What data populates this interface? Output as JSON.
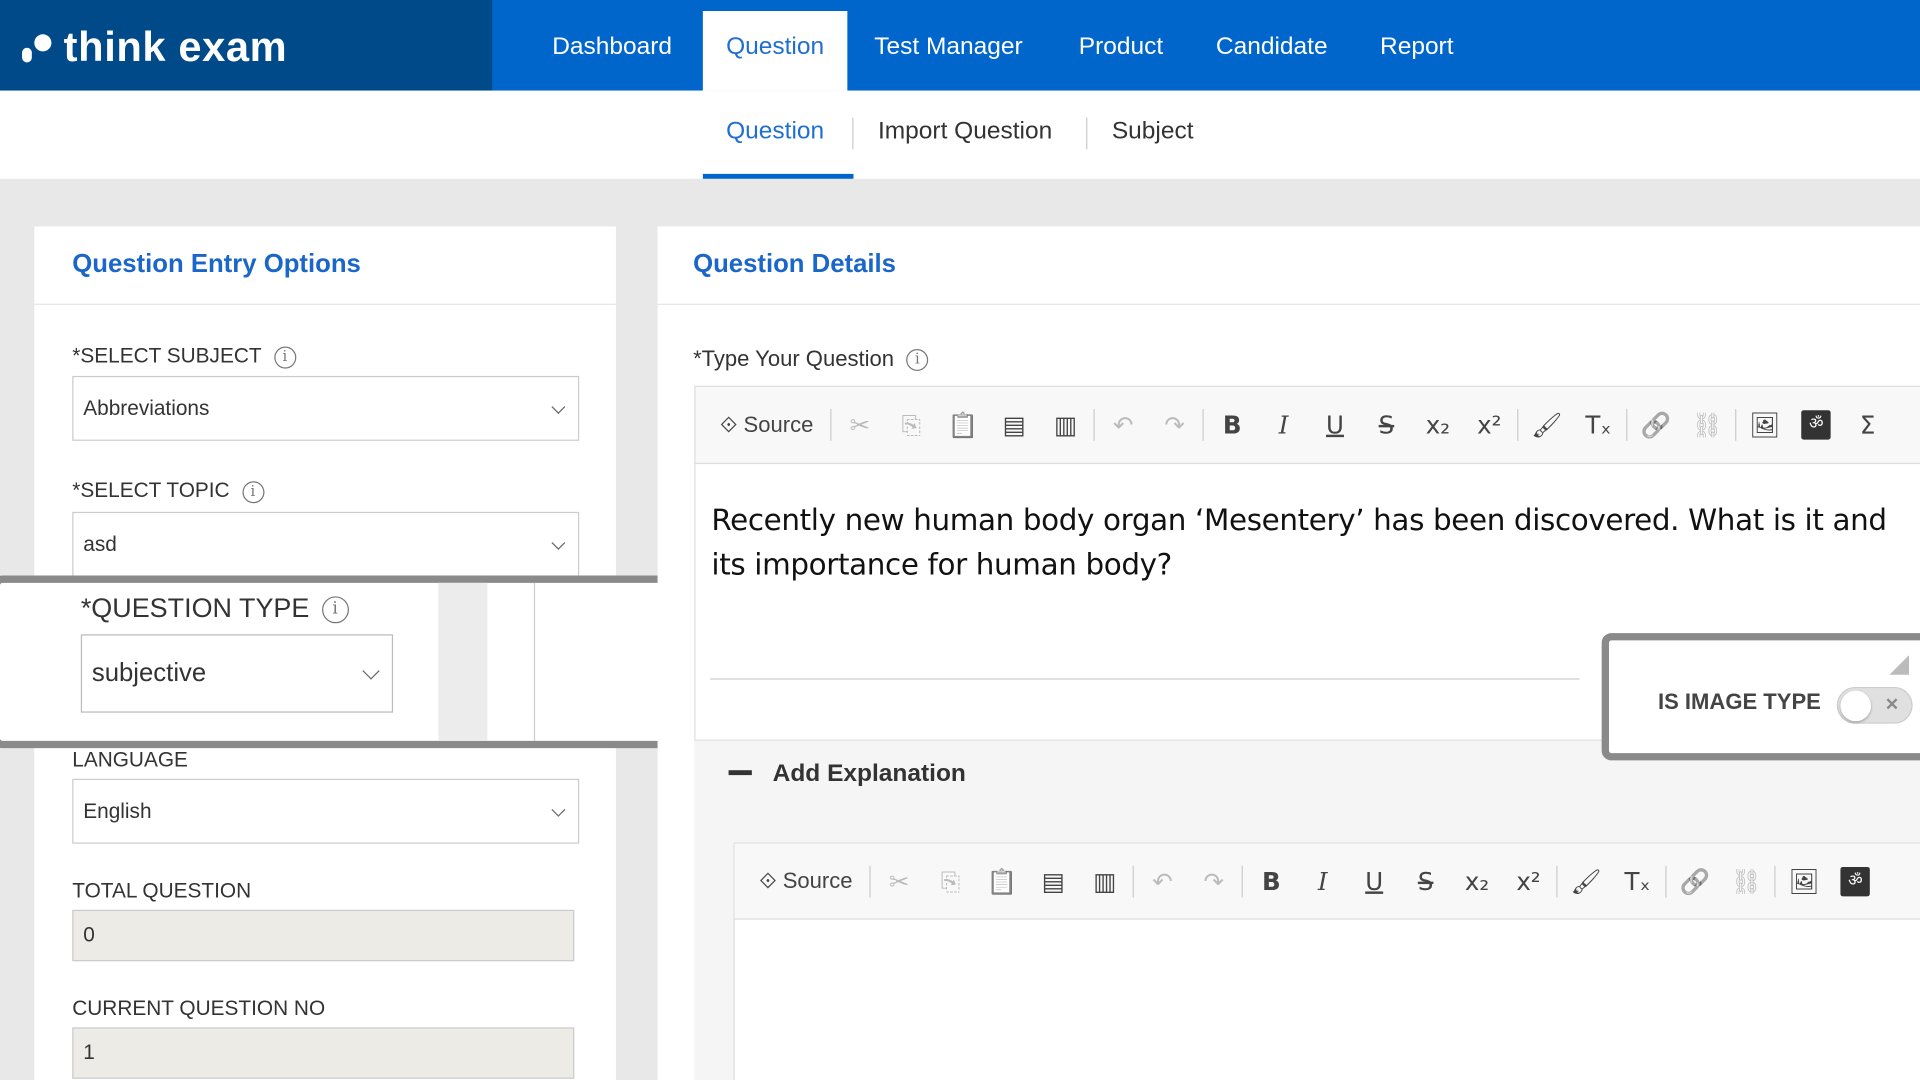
{
  "brand": {
    "name": "think exam",
    "logo_icon": "logo-mark",
    "colors": {
      "header": "#0066cc",
      "logo_bg": "#004a8a",
      "accent": "#1a66c9"
    }
  },
  "nav": [
    {
      "label": "Dashboard"
    },
    {
      "label": "Question",
      "active": true
    },
    {
      "label": "Test Manager"
    },
    {
      "label": "Product"
    },
    {
      "label": "Candidate"
    },
    {
      "label": "Report"
    }
  ],
  "subnav": [
    {
      "label": "Question",
      "active": true
    },
    {
      "label": "Import Question"
    },
    {
      "label": "Subject"
    }
  ],
  "left": {
    "title": "Question Entry Options",
    "subject": {
      "label": "*SELECT SUBJECT",
      "value": "Abbreviations"
    },
    "topic": {
      "label": "*SELECT TOPIC",
      "value": "asd"
    },
    "question_type": {
      "label": "*QUESTION TYPE",
      "value": "subjective"
    },
    "language": {
      "label": "LANGUAGE",
      "value": "English"
    },
    "total_question": {
      "label": "TOTAL QUESTION",
      "value": "0"
    },
    "current_question": {
      "label": "CURRENT QUESTION NO",
      "value": "1"
    }
  },
  "right": {
    "title": "Question Details",
    "question_label": "*Type Your Question",
    "question_text": "Recently new human body organ ‘Mesentery’ has been discovered. What is it and its importance for human body?",
    "image_type_label": "IS IMAGE TYPE",
    "image_type_on": false,
    "explanation_label": "Add Explanation",
    "source_label": "Source"
  },
  "info_glyph": "i"
}
